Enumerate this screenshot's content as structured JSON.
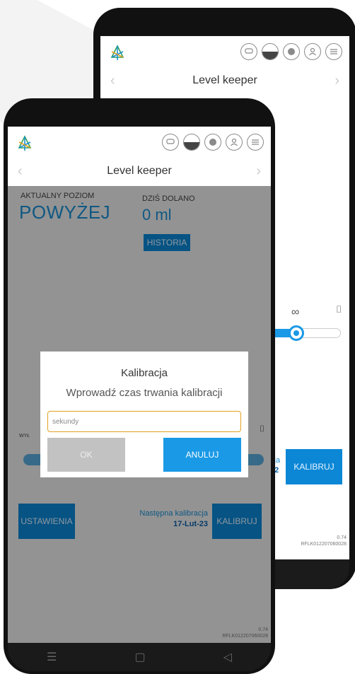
{
  "app": {
    "title": "Level keeper",
    "nav_prev": "‹",
    "nav_next": "›"
  },
  "status": {
    "current_level_label": "AKTUALNY POZIOM",
    "current_level_value": "POWYŻEJ",
    "today_added_label": "DZIŚ DOLANO",
    "today_added_value": "0 ml"
  },
  "buttons": {
    "history": "HISTORIA",
    "settings": "USTAWIENIA",
    "calibrate": "KALIBRUJ"
  },
  "calibration": {
    "next_label": "Następna kalibracja",
    "next_date": "17-Lut-23",
    "back_label_fragment": "cja",
    "back_date_fragment": "22"
  },
  "slider": {
    "left_label": "WYŁ",
    "infinity_symbol": "∞",
    "cup_symbol": "⌷"
  },
  "device": {
    "version": "0.74",
    "serial": "RFLK012207060028"
  },
  "dialog": {
    "title": "Kalibracja",
    "message": "Wprowadź czas trwania kalibracji",
    "input_placeholder": "sekundy",
    "ok_label": "OK",
    "cancel_label": "ANULUJ"
  },
  "navbar": {
    "menu": "☰",
    "home": "▢",
    "back": "◁"
  },
  "colors": {
    "accent": "#1a8fd4",
    "button_blue": "#0b87d6",
    "input_border": "#e0a020"
  }
}
